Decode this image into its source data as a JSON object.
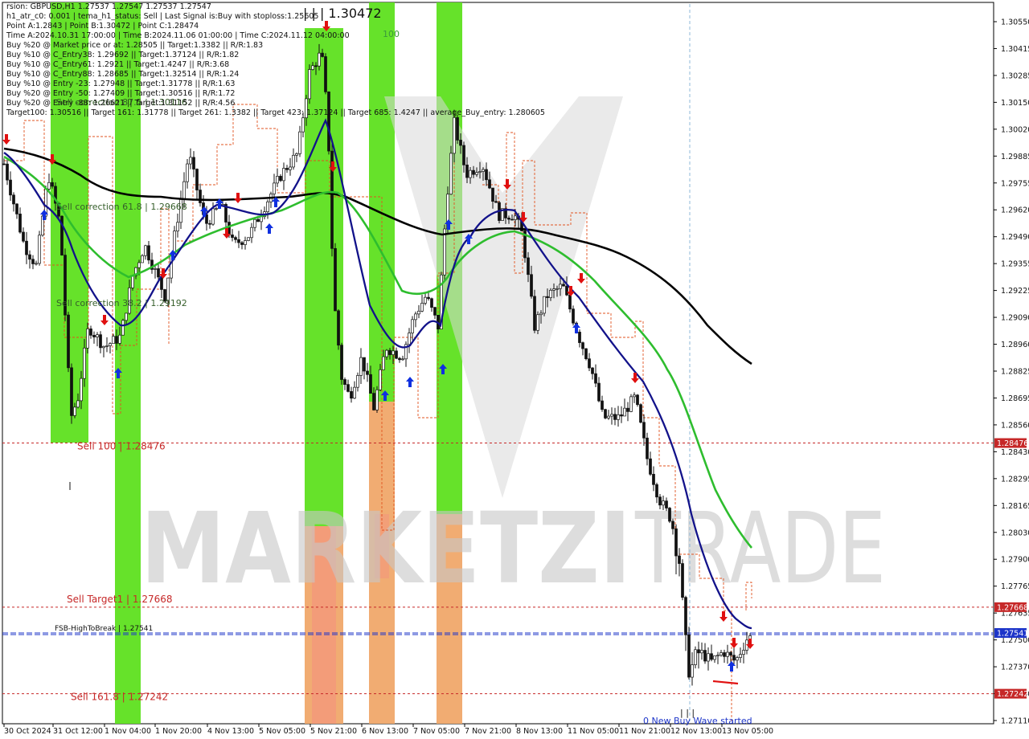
{
  "header": {
    "title_prefix": "rsion:",
    "lines": [
      "GBPUSD,H1  1.27537 1.27547 1.27537 1.27547",
      "h1_atr_c0: 0.001  |  tema_h1_status: Sell  |  Last Signal is:Buy with stoploss:1.25605",
      "Point A:1.2843  |  Point B:1.30472  |  Point C:1.28474",
      "Time A:2024.10.31 17:00:00  |  Time B:2024.11.06 01:00:00  |  Time C:2024.11.12 04:00:00",
      "Buy %20 @ Market price or at: 1.28505  ||  Target:1.3382  ||  R/R:1.83",
      "Buy %10 @ C_Entry38: 1.29692  ||  Target:1.37124  ||  R/R:1.82",
      "Buy %10 @ C_Entry61: 1.2921  ||  Target:1.4247  ||  R/R:3.68",
      "Buy %10 @ C_Entry88: 1.28685  ||  Target:1.32514  ||  R/R:1.24",
      "Buy %10 @ Entry -23: 1.27948  ||  Target:1.31778  ||  R/R:1.63",
      "Buy %20 @ Entry -50: 1.27409  ||  Target:1.30516  ||  R/R:1.72",
      "Buy %20 @ Entry -88: 1.26621  ||  Target:1.31152  ||  R/R:4.56",
      "Target100: 1.30516  ||  Target 161: 1.31778  ||  Target 261: 1.3382  ||  Target 423: 1.37124  ||  Target 685: 1.4247  ||  average_Buy_entry: 1.280605"
    ]
  },
  "watermark": {
    "left": "MARKETZI",
    "right": "TRADE"
  },
  "chart_data": {
    "type": "candlestick",
    "symbol": "GBPUSD",
    "timeframe": "H1",
    "ylim": [
      1.2705,
      1.3065
    ],
    "y_ticks": [
      "1.30550",
      "1.30415",
      "1.30285",
      "1.30150",
      "1.30020",
      "1.29885",
      "1.29755",
      "1.29620",
      "1.29490",
      "1.29355",
      "1.29225",
      "1.29090",
      "1.28960",
      "1.28825",
      "1.28695",
      "1.28560",
      "1.28430",
      "1.28295",
      "1.28165",
      "1.28030",
      "1.27900",
      "1.27765",
      "1.27635",
      "1.27500",
      "1.27370",
      "1.27240",
      "1.27110"
    ],
    "x_ticks": [
      "30 Oct 2024",
      "31 Oct 12:00",
      "1 Nov 04:00",
      "1 Nov 20:00",
      "4 Nov 13:00",
      "5 Nov 05:00",
      "5 Nov 21:00",
      "6 Nov 13:00",
      "7 Nov 05:00",
      "7 Nov 21:00",
      "8 Nov 13:00",
      "11 Nov 05:00",
      "11 Nov 21:00",
      "12 Nov 13:00",
      "13 Nov 05:00"
    ],
    "price_labels": [
      {
        "text": "1.28476",
        "value": 1.28476,
        "color": "#c62828"
      },
      {
        "text": "1.27668",
        "value": 1.27668,
        "color": "#c62828"
      },
      {
        "text": "1.27541",
        "value": 1.27541,
        "color": "#1d35c9"
      },
      {
        "text": "1.27242",
        "value": 1.27242,
        "color": "#c62828"
      }
    ],
    "level_labels": [
      {
        "text": "Sell 100 | 1.28476",
        "value": 1.28476
      },
      {
        "text": "Sell Target1 | 1.27668",
        "value": 1.27668
      },
      {
        "text": "FSB-HighToBreak | 1.27541",
        "value": 1.27541
      },
      {
        "text": "Sell 161.8 | 1.27242",
        "value": 1.27242
      }
    ],
    "annotations": [
      {
        "text": "Sell correction 61.8 | 1.29668",
        "color": "#355e2a"
      },
      {
        "text": "Sell correction 38.2 | 1.29192",
        "color": "#355e2a"
      },
      {
        "text": "Sell correction 87.5 | 1.30116",
        "color": "#355e2a"
      },
      {
        "text": "| | | 1.30472",
        "color": "#111111"
      },
      {
        "text": "100",
        "color": "#3a9b3a"
      },
      {
        "text": "| | |",
        "color": "#111111"
      },
      {
        "text": "0 New Buy Wave started",
        "color": "#1d35c9"
      }
    ],
    "colors": {
      "candle": "#111111",
      "ma_black": "#000000",
      "ma_green": "#2ebd2e",
      "ma_navy": "#12128a",
      "zone_green": "#5ee01f",
      "zone_orange": "#f0a86a",
      "zone_salmon": "#f49080",
      "sell_arrow": "#e01010",
      "buy_arrow": "#1030e0",
      "level_red": "#c62828",
      "level_blue": "#1d35c9"
    }
  }
}
